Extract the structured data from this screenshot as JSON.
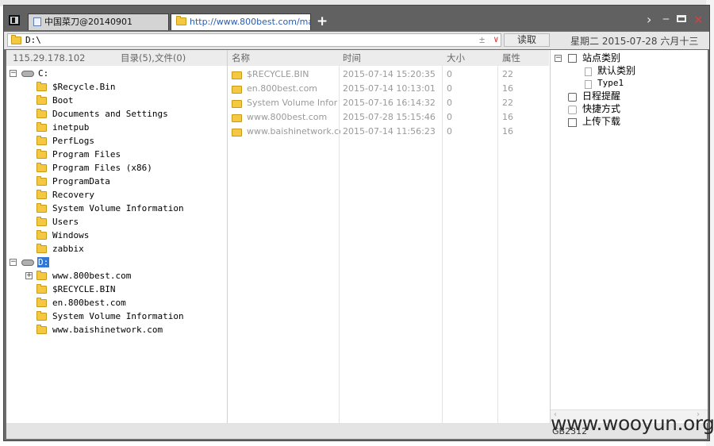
{
  "tabs": [
    {
      "label": "中国菜刀@20140901",
      "active": false
    },
    {
      "label": "http://www.800best.com/ma...",
      "active": true
    }
  ],
  "address": {
    "path": "D:\\",
    "read_button": "读取",
    "date": "星期二 2015-07-28 六月十三"
  },
  "left_panel": {
    "ip": "115.29.178.102",
    "stats": "目录(5),文件(0)",
    "tree": [
      {
        "label": "C:",
        "type": "drive",
        "expander": "−"
      },
      {
        "label": "$Recycle.Bin",
        "type": "folder"
      },
      {
        "label": "Boot",
        "type": "folder"
      },
      {
        "label": "Documents and Settings",
        "type": "folder"
      },
      {
        "label": "inetpub",
        "type": "folder"
      },
      {
        "label": "PerfLogs",
        "type": "folder"
      },
      {
        "label": "Program Files",
        "type": "folder"
      },
      {
        "label": "Program Files (x86)",
        "type": "folder"
      },
      {
        "label": "ProgramData",
        "type": "folder"
      },
      {
        "label": "Recovery",
        "type": "folder"
      },
      {
        "label": "System Volume Information",
        "type": "folder"
      },
      {
        "label": "Users",
        "type": "folder"
      },
      {
        "label": "Windows",
        "type": "folder"
      },
      {
        "label": "zabbix",
        "type": "folder"
      },
      {
        "label": "D:",
        "type": "drive",
        "expander": "−",
        "selected": true
      },
      {
        "label": "www.800best.com",
        "type": "folder",
        "expander": "+"
      },
      {
        "label": "$RECYCLE.BIN",
        "type": "folder"
      },
      {
        "label": "en.800best.com",
        "type": "folder"
      },
      {
        "label": "System Volume Information",
        "type": "folder"
      },
      {
        "label": "www.baishinetwork.com",
        "type": "folder"
      }
    ]
  },
  "file_list": {
    "columns": [
      "名称",
      "时间",
      "大小",
      "属性"
    ],
    "rows": [
      {
        "name": "$RECYCLE.BIN",
        "time": "2015-07-14 15:20:35",
        "size": "0",
        "attr": "22"
      },
      {
        "name": "en.800best.com",
        "time": "2015-07-14 10:13:01",
        "size": "0",
        "attr": "16"
      },
      {
        "name": "System Volume Inform...",
        "time": "2015-07-16 16:14:32",
        "size": "0",
        "attr": "22"
      },
      {
        "name": "www.800best.com",
        "time": "2015-07-28 15:15:46",
        "size": "0",
        "attr": "16"
      },
      {
        "name": "www.baishinetwork.com",
        "time": "2015-07-14 11:56:23",
        "size": "0",
        "attr": "16"
      }
    ]
  },
  "right_panel": {
    "items": [
      {
        "label": "站点类别",
        "icon": "checkbox",
        "expander": "−"
      },
      {
        "label": "默认类别",
        "icon": "doc-icon"
      },
      {
        "label": "Type1",
        "icon": "doc-icon"
      },
      {
        "label": "日程提醒",
        "icon": "clock-icon"
      },
      {
        "label": "快捷方式",
        "icon": "hand-icon"
      },
      {
        "label": "上传下载",
        "icon": "checkbox"
      }
    ]
  },
  "status": {
    "encoding": "GB2312",
    "watermark": "www.wooyun.org"
  }
}
